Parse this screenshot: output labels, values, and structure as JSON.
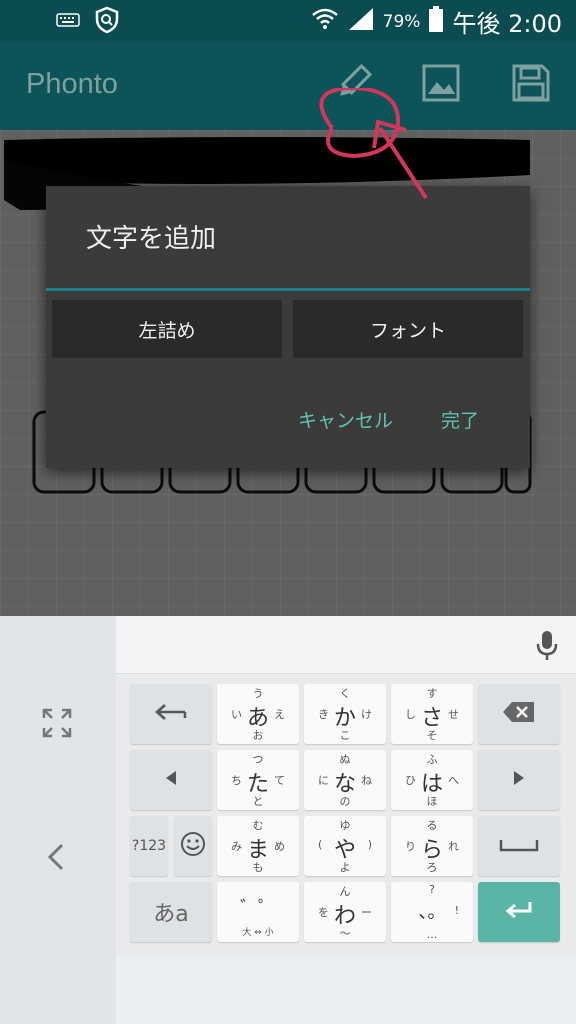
{
  "status_bar": {
    "battery_percent": "79%",
    "time": "午後 2:00",
    "icons": [
      "keyboard-icon",
      "vpn-shield-icon",
      "wifi-icon",
      "signal-icon",
      "battery-icon"
    ]
  },
  "app_bar": {
    "title": "Phonto",
    "actions": [
      "pencil-icon",
      "image-icon",
      "save-icon"
    ]
  },
  "dialog": {
    "title": "文字を追加",
    "align_button": "左詰め",
    "font_button": "フォント",
    "cancel_button": "キャンセル",
    "done_button": "完了"
  },
  "keyboard": {
    "row1": [
      {
        "c": "あ",
        "u": "う",
        "l": "い",
        "r": "え",
        "d": "お"
      },
      {
        "c": "か",
        "u": "く",
        "l": "き",
        "r": "け",
        "d": "こ"
      },
      {
        "c": "さ",
        "u": "す",
        "l": "し",
        "r": "せ",
        "d": "そ"
      }
    ],
    "row2": [
      {
        "c": "た",
        "u": "つ",
        "l": "ち",
        "r": "て",
        "d": "と"
      },
      {
        "c": "な",
        "u": "ぬ",
        "l": "に",
        "r": "ね",
        "d": "の"
      },
      {
        "c": "は",
        "u": "ふ",
        "l": "ひ",
        "r": "へ",
        "d": "ほ"
      }
    ],
    "row3": [
      {
        "c": "ま",
        "u": "む",
        "l": "み",
        "r": "め",
        "d": "も"
      },
      {
        "c": "や",
        "u": "ゆ",
        "l": "(",
        "r": ")",
        "d": "よ"
      },
      {
        "c": "ら",
        "u": "る",
        "l": "り",
        "r": "れ",
        "d": "ろ"
      }
    ],
    "row4": [
      {
        "c": "゛゜",
        "d": "大 ⇔ 小"
      },
      {
        "c": "わ",
        "u": "ん",
        "l": "を",
        "r": "ー",
        "d": "〜"
      },
      {
        "c": "、。",
        "u": "?",
        "r": "!",
        "d": "…"
      }
    ],
    "num_key": "?123",
    "mode_key": "あa",
    "accent": "#5bb5a6"
  },
  "colors": {
    "status_bar": "#0a4c4f",
    "app_bar": "#0c5457",
    "dialog_bg": "#3b3b3b",
    "dialog_accent": "#5fc3b3",
    "annotation": "#d2365a"
  }
}
